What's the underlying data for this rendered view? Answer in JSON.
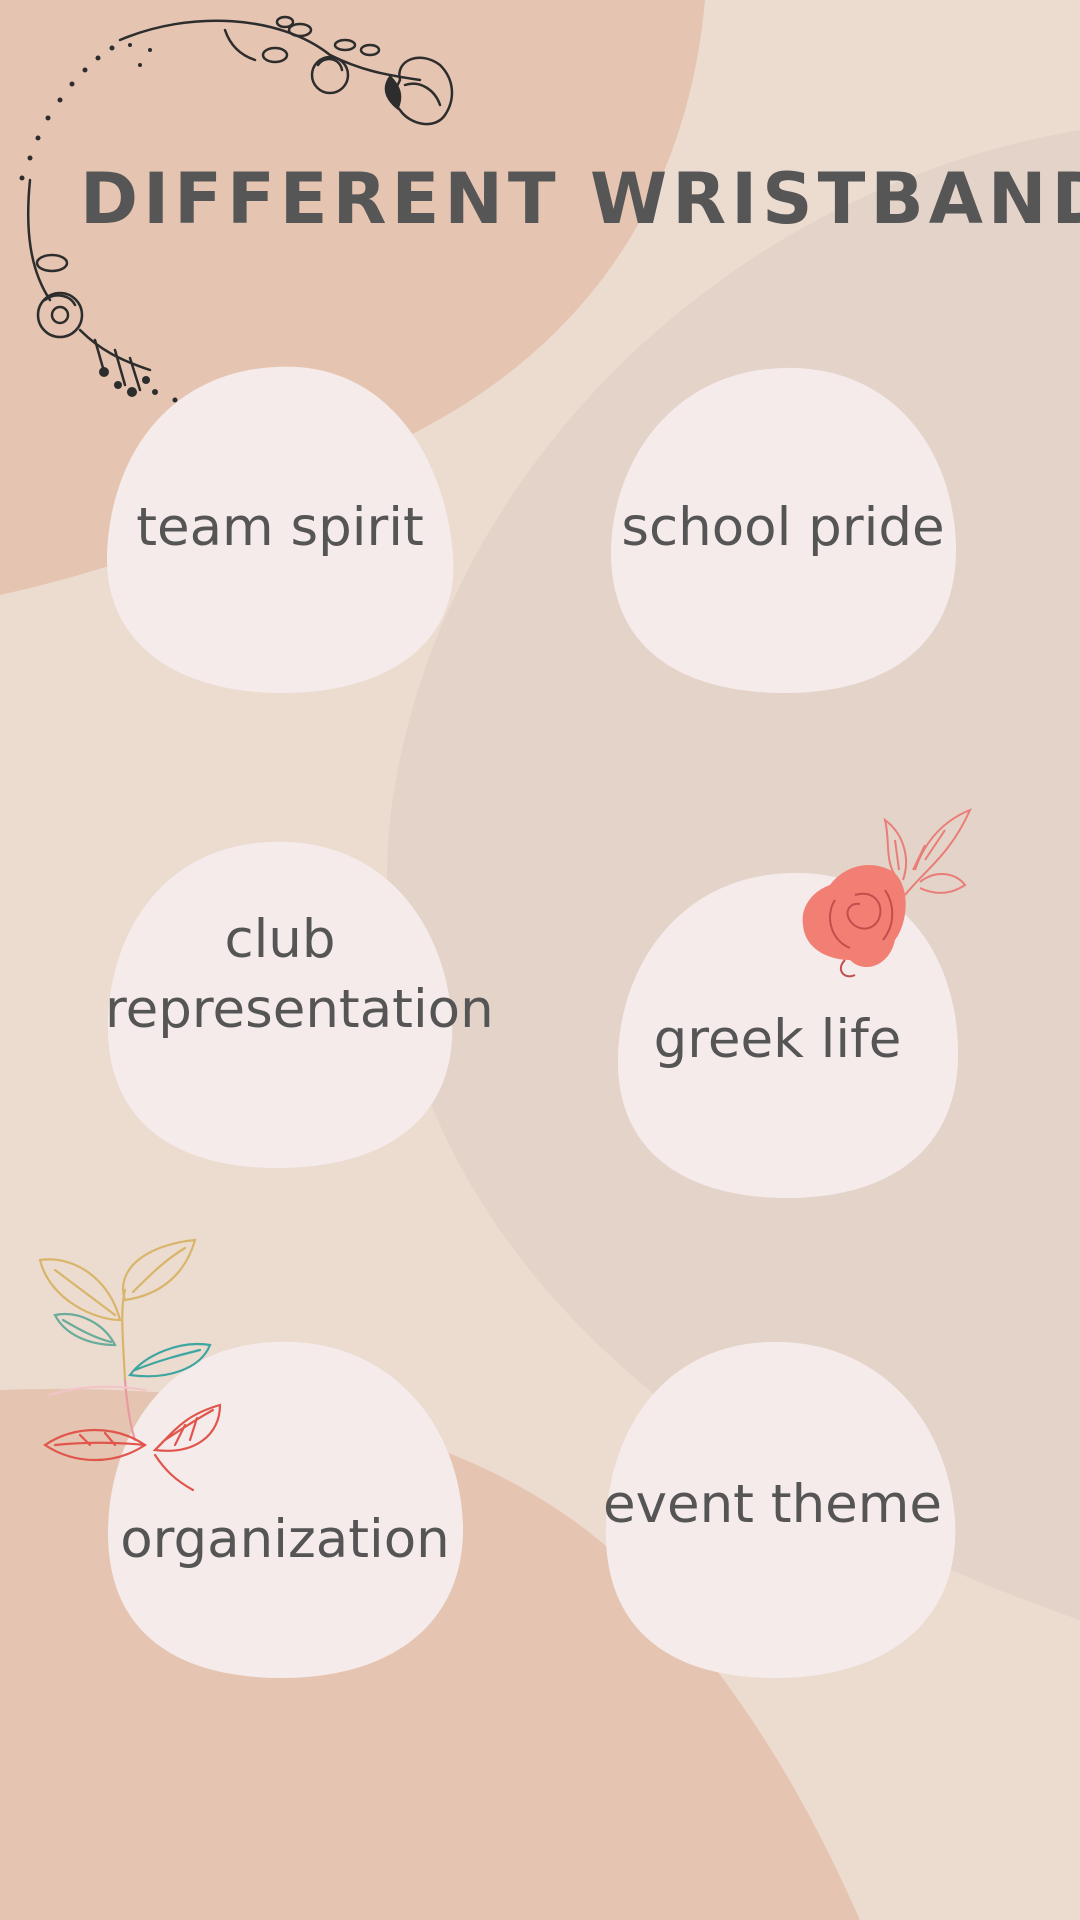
{
  "title": "DIFFERENT WRISTBANDS",
  "items": [
    {
      "label": "team spirit"
    },
    {
      "label": "school pride"
    },
    {
      "label": "club representation",
      "line1": "club",
      "line2": "representation"
    },
    {
      "label": "greek life"
    },
    {
      "label": "organization"
    },
    {
      "label": "event theme"
    }
  ],
  "colors": {
    "background": "#ecdcd0",
    "peach": "#e5c5b1",
    "taupe": "#e3d3c8",
    "blob": "#f5ebea",
    "text": "#555555",
    "rose": "#f27f73"
  },
  "icons": [
    "floral-wreath-icon",
    "rose-icon",
    "leaves-icon"
  ]
}
